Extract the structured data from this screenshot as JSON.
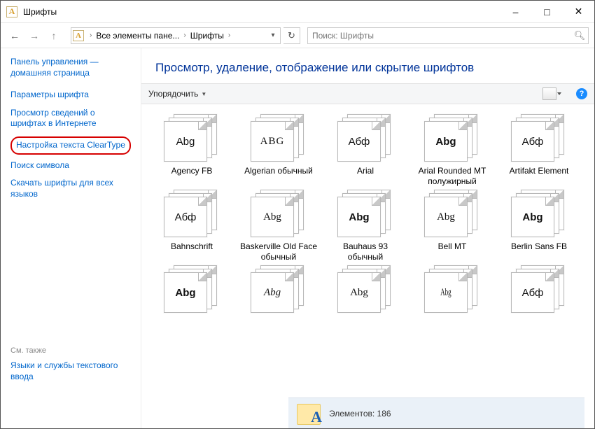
{
  "window": {
    "title": "Шрифты",
    "icon_glyph": "A"
  },
  "nav": {
    "breadcrumb": {
      "root": "Все элементы пане...",
      "current": "Шрифты"
    },
    "search_placeholder": "Поиск: Шрифты"
  },
  "sidebar": {
    "home": "Панель управления — домашняя страница",
    "links": [
      "Параметры шрифта",
      "Просмотр сведений о шрифтах в Интернете",
      "Настройка текста ClearType",
      "Поиск символа",
      "Скачать шрифты для всех языков"
    ],
    "highlighted_index": 2,
    "see_also_label": "См. также",
    "see_also_link": "Языки и службы текстового ввода"
  },
  "main": {
    "heading": "Просмотр, удаление, отображение или скрытие шрифтов",
    "toolbar": {
      "organize": "Упорядочить"
    },
    "fonts": [
      {
        "label": "Agency FB",
        "sample": "Abg",
        "style": "font-family:'Agency FB',sans-serif;"
      },
      {
        "label": "Algerian обычный",
        "sample": "ABG",
        "style": "font-family:serif;font-variant:small-caps;letter-spacing:1px;"
      },
      {
        "label": "Arial",
        "sample": "Абф",
        "style": "font-family:Arial,sans-serif;"
      },
      {
        "label": "Arial Rounded MT полужирный",
        "sample": "Abg",
        "style": "font-family:'Arial Rounded MT Bold',Arial,sans-serif;font-weight:bold;"
      },
      {
        "label": "Artifakt Element",
        "sample": "Абф",
        "style": "font-family:Arial,sans-serif;"
      },
      {
        "label": "Bahnschrift",
        "sample": "Абф",
        "style": "font-family:Bahnschrift,Arial,sans-serif;"
      },
      {
        "label": "Baskerville Old Face обычный",
        "sample": "Abg",
        "style": "font-family:'Baskerville Old Face',Georgia,serif;"
      },
      {
        "label": "Bauhaus 93 обычный",
        "sample": "Abg",
        "style": "font-family:'Bauhaus 93',Arial Black,sans-serif;font-weight:900;"
      },
      {
        "label": "Bell MT",
        "sample": "Abg",
        "style": "font-family:'Bell MT',Georgia,serif;"
      },
      {
        "label": "Berlin Sans FB",
        "sample": "Abg",
        "style": "font-family:'Berlin Sans FB',Arial,sans-serif;font-weight:bold;"
      },
      {
        "label": "",
        "sample": "Abg",
        "style": "font-family:Arial Black,sans-serif;font-weight:900;"
      },
      {
        "label": "",
        "sample": "Abg",
        "style": "font-family:'Brush Script MT',cursive;font-style:italic;"
      },
      {
        "label": "",
        "sample": "Abg",
        "style": "font-family:Georgia,serif;"
      },
      {
        "label": "",
        "sample": "Abg",
        "style": "font-family:'Times New Roman',serif;transform:scaleX(0.6);"
      },
      {
        "label": "",
        "sample": "Абф",
        "style": "font-family:Arial,sans-serif;"
      }
    ]
  },
  "status": {
    "items_label": "Элементов:",
    "items_count": "186"
  }
}
